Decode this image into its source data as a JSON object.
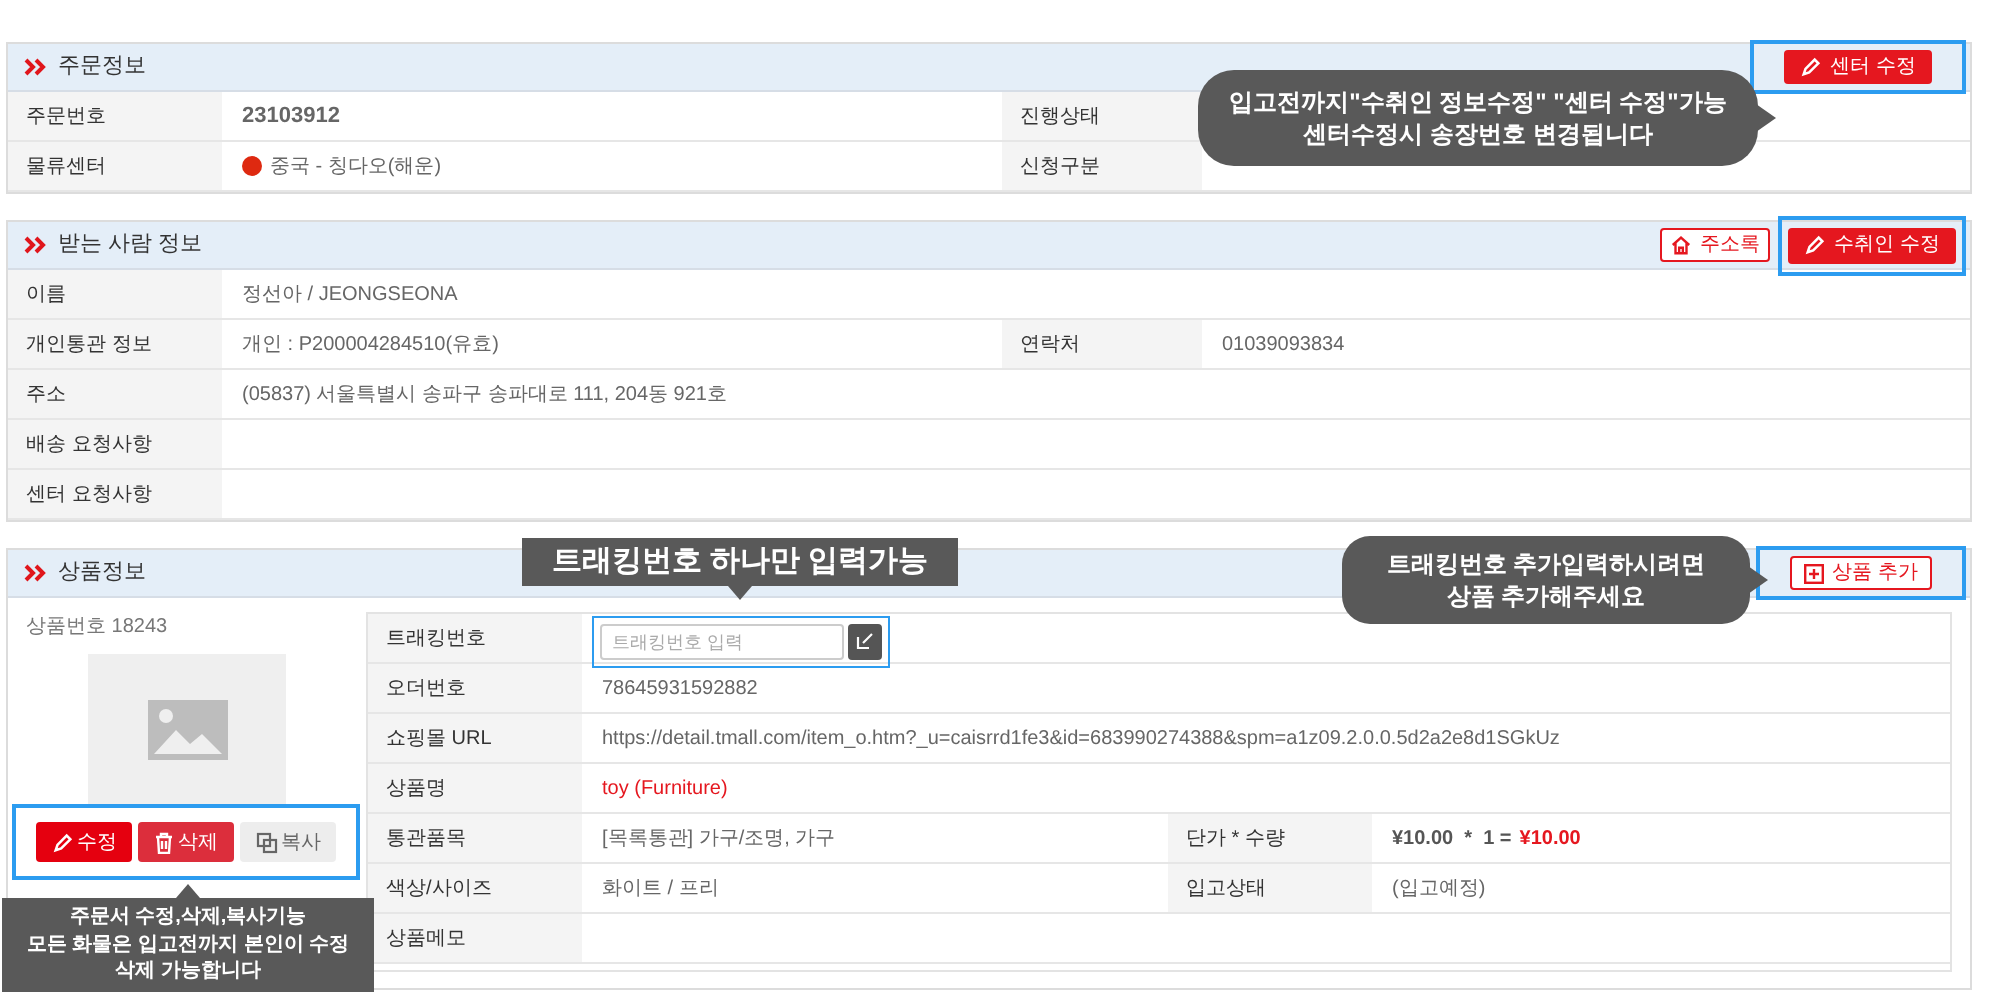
{
  "order_info": {
    "title": "주문정보",
    "edit_button": "센터 수정",
    "callout": "입고전까지\"수취인 정보수정\" \"센터 수정\"가능\n센터수정시 송장번호 변경됩니다",
    "rows": [
      {
        "label": "주문번호",
        "value": "23103912",
        "label_2": "진행상태",
        "kind": "bold"
      },
      {
        "label": "물류센터",
        "value": "중국 - 칭다오(해운)",
        "label_2": "신청구분",
        "kind": "flag"
      }
    ]
  },
  "recipient": {
    "title": "받는 사람 정보",
    "address_book_button": "주소록",
    "edit_button": "수취인 수정",
    "rows": [
      {
        "label": "이름",
        "value": "정선아 / JEONGSEONA"
      },
      {
        "label": "개인통관 정보",
        "value": "개인 : P200004284510(유효)",
        "label_2": "연락처",
        "value_2": "01039093834"
      },
      {
        "label": "주소",
        "value": "(05837) 서울특별시 송파구 송파대로 111, 204동 921호"
      },
      {
        "label": "배송 요청사항"
      },
      {
        "label": "센터 요청사항"
      }
    ]
  },
  "product": {
    "title": "상품정보",
    "add_button": "상품 추가",
    "callout": "트래킹번호 추가입력하시려면\n상품 추가해주세요",
    "tracking_callout": "트래킹번호 하나만 입력가능",
    "product_number": "상품번호 18243",
    "actions": [
      {
        "label": "수정",
        "kind": "edit"
      },
      {
        "label": "삭제",
        "kind": "delete"
      },
      {
        "label": "복사",
        "kind": "copy"
      }
    ],
    "actions_callout": "주문서 수정,삭제,복사기능\n모든 화물은 입고전까지 본인이 수정\n삭제 가능합니다",
    "rows": [
      {
        "label": "트래킹번호",
        "kind": "input",
        "placeholder": "트래킹번호 입력"
      },
      {
        "label": "오더번호",
        "kind": "text",
        "value": "78645931592882"
      },
      {
        "label": "쇼핑몰 URL",
        "kind": "text",
        "value": "https://detail.tmall.com/item_o.htm?_u=caisrrd1fe3&id=683990274388&spm=a1z09.2.0.0.5d2a2e8d1SGkUz"
      },
      {
        "label": "상품명",
        "kind": "accent",
        "value": "toy (Furniture)"
      },
      {
        "label": "통관품목",
        "kind": "price",
        "value": "[목록통관] 가구/조명, 가구",
        "label_2": "단가 * 수량",
        "formula": "¥10.00  *  1 =",
        "total": "¥10.00"
      },
      {
        "label": "색상/사이즈",
        "kind": "text",
        "value": "화이트 / 프리",
        "label_2": "입고상태",
        "value_2": "(입고예정)"
      },
      {
        "label": "상품메모",
        "kind": "text"
      }
    ]
  }
}
